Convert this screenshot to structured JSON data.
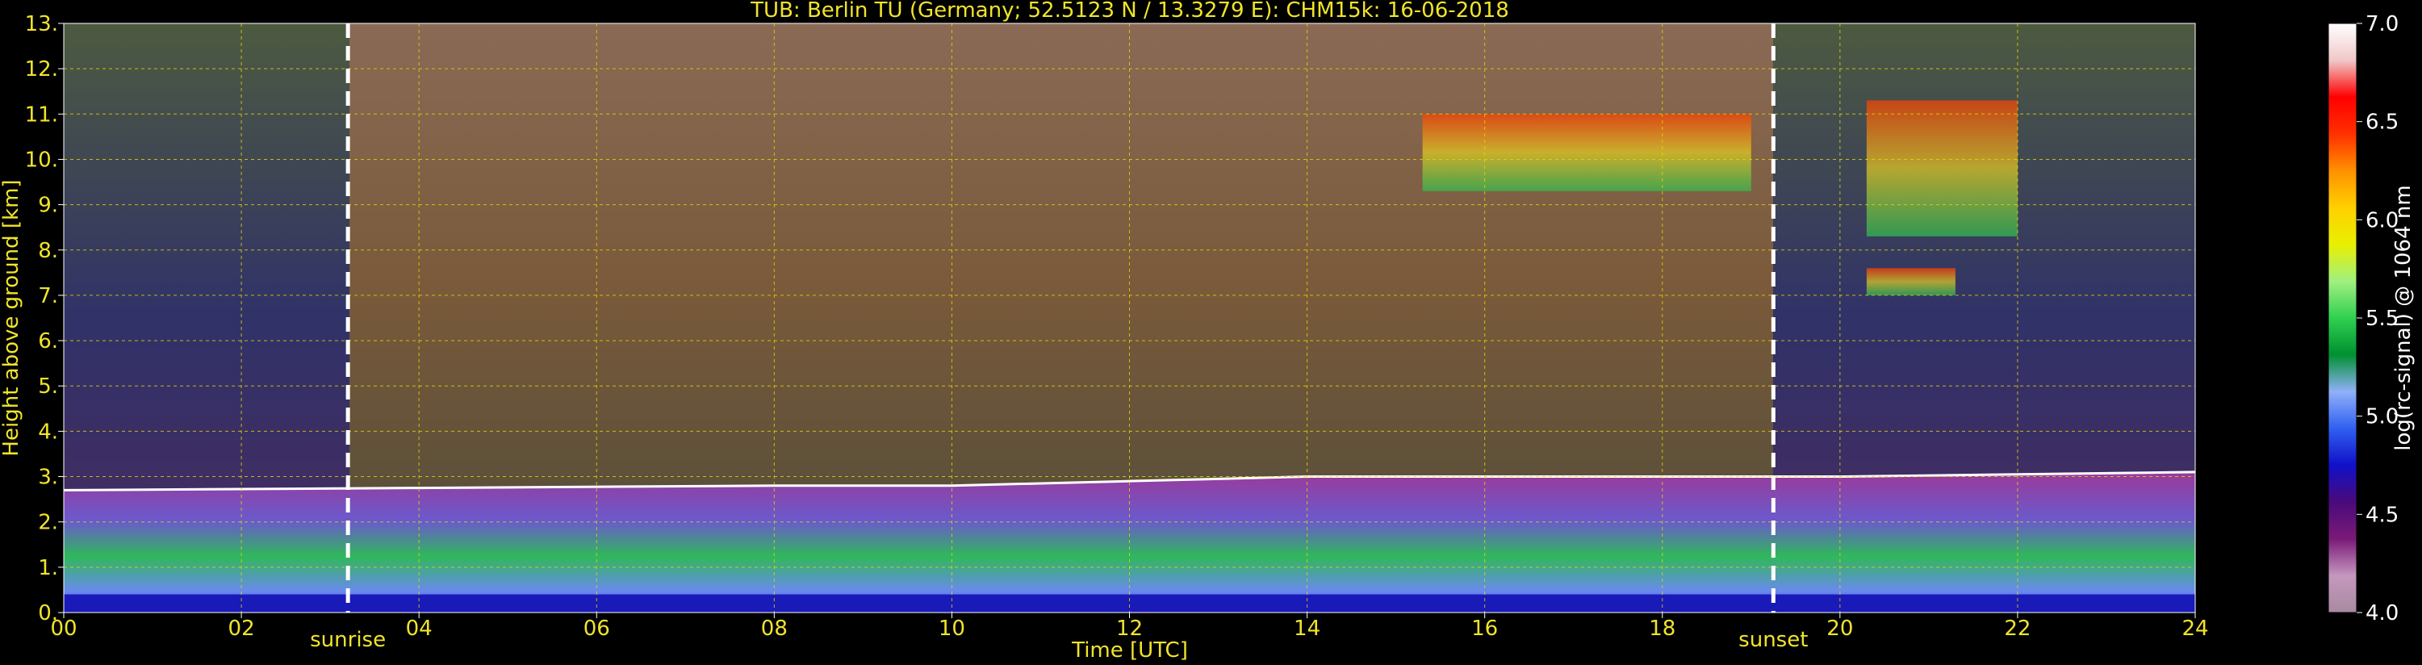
{
  "chart_data": {
    "type": "heatmap",
    "title": "TUB: Berlin TU (Germany; 52.5123 N / 13.3279 E):    CHM15k: 16-06-2018",
    "xlabel": "Time [UTC]",
    "ylabel": "Height above ground [km]",
    "xlim": [
      0,
      24
    ],
    "ylim": [
      0,
      13
    ],
    "x_ticks": [
      "00",
      "02",
      "04",
      "06",
      "08",
      "10",
      "12",
      "14",
      "16",
      "18",
      "20",
      "22",
      "24"
    ],
    "x_tick_values": [
      0,
      2,
      4,
      6,
      8,
      10,
      12,
      14,
      16,
      18,
      20,
      22,
      24
    ],
    "y_ticks": [
      "0.",
      "1.",
      "2.",
      "3.",
      "4.",
      "5.",
      "6.",
      "7.",
      "8.",
      "9.",
      "10.",
      "11.",
      "12.",
      "13."
    ],
    "y_tick_values": [
      0,
      1,
      2,
      3,
      4,
      5,
      6,
      7,
      8,
      9,
      10,
      11,
      12,
      13
    ],
    "grid": true,
    "colorbar": {
      "label": "log(rc-signal) @ 1064 nm",
      "range": [
        4.0,
        7.0
      ],
      "ticks": [
        "4.0",
        "4.5",
        "5.0",
        "5.5",
        "6.0",
        "6.5",
        "7.0"
      ],
      "tick_values": [
        4.0,
        4.5,
        5.0,
        5.5,
        6.0,
        6.5,
        7.0
      ],
      "colors": [
        "#a88aa0",
        "#c498be",
        "#7a1a78",
        "#4a0a7a",
        "#1010c8",
        "#3060f0",
        "#90b0f8",
        "#009030",
        "#30d050",
        "#a0f080",
        "#e8f000",
        "#ffd000",
        "#ff9000",
        "#ff3000",
        "#ff0000",
        "#f0c8c8",
        "#ffffff"
      ]
    },
    "events": [
      {
        "label": "sunrise",
        "time": 3.2
      },
      {
        "label": "sunset",
        "time": 19.25
      }
    ],
    "cloud_base_height_km": [
      {
        "time": 0,
        "height": 2.7
      },
      {
        "time": 4,
        "height": 2.75
      },
      {
        "time": 8,
        "height": 2.8
      },
      {
        "time": 10,
        "height": 2.8
      },
      {
        "time": 12,
        "height": 2.9
      },
      {
        "time": 14,
        "height": 3.0
      },
      {
        "time": 16,
        "height": 3.0
      },
      {
        "time": 18,
        "height": 3.0
      },
      {
        "time": 20,
        "height": 3.0
      },
      {
        "time": 22,
        "height": 3.05
      },
      {
        "time": 24,
        "height": 3.1
      }
    ],
    "cirrus_clouds": [
      {
        "time_start": 15.3,
        "time_end": 19.0,
        "height_bottom": 9.3,
        "height_top": 11.0
      },
      {
        "time_start": 20.3,
        "time_end": 22.0,
        "height_bottom": 8.3,
        "height_top": 11.3
      },
      {
        "time_start": 20.3,
        "time_end": 21.3,
        "height_bottom": 7.0,
        "height_top": 7.6
      }
    ]
  },
  "colors": {
    "text": "#f0e42a",
    "grid": "#e8d800",
    "event_lines": "#ffffff"
  }
}
